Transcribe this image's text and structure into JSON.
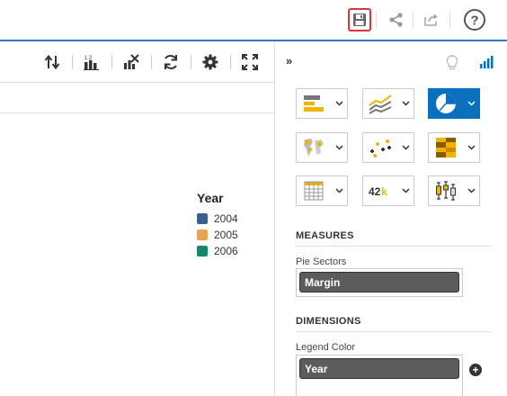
{
  "toolbar": {
    "save_icon": "floppy-disk-icon",
    "share_icon": "share-icon",
    "export_icon": "export-icon",
    "help_icon": "help-circle-icon",
    "help_glyph": "?"
  },
  "chart_toolbar": {
    "buttons": [
      "sort-icon",
      "ranking-icon",
      "remove-chart-icon",
      "refresh-icon",
      "settings-gear-icon",
      "fullscreen-icon"
    ]
  },
  "legend": {
    "title": "Year",
    "items": [
      {
        "label": "2004",
        "color": "#3b5f8f"
      },
      {
        "label": "2005",
        "color": "#f0a24b"
      },
      {
        "label": "2006",
        "color": "#0f8a6a"
      }
    ]
  },
  "panel": {
    "collapse_label": "»",
    "chart_types": [
      {
        "name": "bar-chart-icon",
        "active": false
      },
      {
        "name": "line-chart-icon",
        "active": false
      },
      {
        "name": "pie-chart-icon",
        "active": true
      },
      {
        "name": "geo-map-icon",
        "active": false
      },
      {
        "name": "scatter-plot-icon",
        "active": false
      },
      {
        "name": "heatmap-icon",
        "active": false
      },
      {
        "name": "table-icon",
        "active": false
      },
      {
        "name": "numeric-point-icon",
        "active": false,
        "text": "42k"
      },
      {
        "name": "box-plot-icon",
        "active": false
      }
    ],
    "measures": {
      "title": "MEASURES",
      "field_label": "Pie Sectors",
      "value": "Margin"
    },
    "dimensions": {
      "title": "DIMENSIONS",
      "field_label": "Legend Color",
      "value": "Year",
      "add_glyph": "+"
    }
  },
  "colors": {
    "accent_blue": "#0a6fbd",
    "highlight_red": "#e0343a",
    "top_line": "#2f7bbf"
  }
}
